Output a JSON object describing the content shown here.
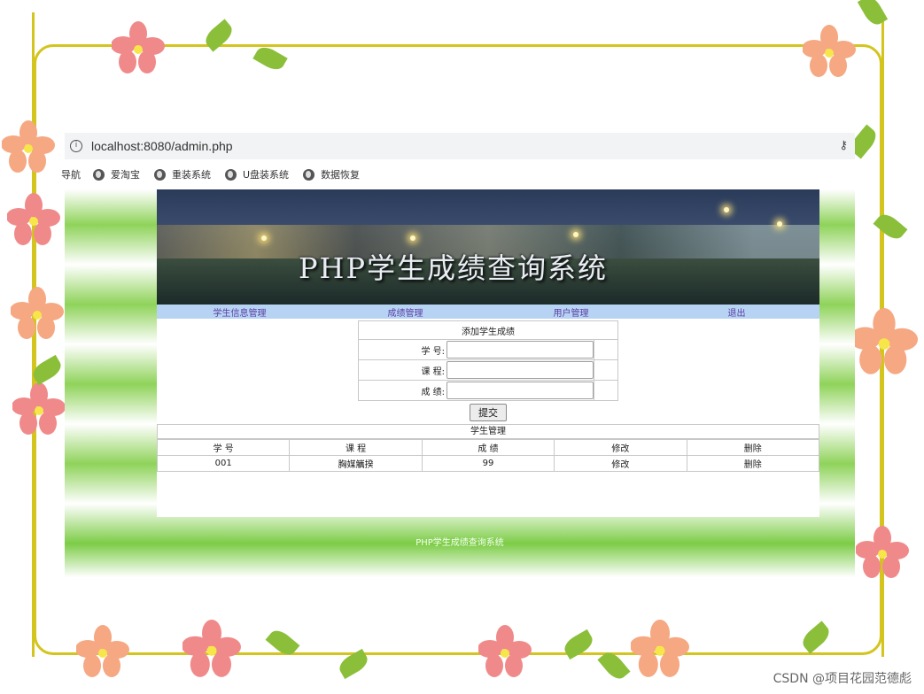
{
  "browser": {
    "url": "localhost:8080/admin.php",
    "bookmarks": [
      "导航",
      "爱淘宝",
      "重装系统",
      "U盘装系统",
      "数据恢复"
    ]
  },
  "site": {
    "banner_title": "PHP学生成绩查询系统",
    "nav": [
      "学生信息管理",
      "成绩管理",
      "用户管理",
      "退出"
    ],
    "form": {
      "title": "添加学生成绩",
      "fields": [
        {
          "label": "学  号:",
          "value": ""
        },
        {
          "label": "课  程:",
          "value": ""
        },
        {
          "label": "成  绩:",
          "value": ""
        }
      ],
      "submit_label": "提交"
    },
    "table": {
      "title": "学生管理",
      "headers": [
        "学  号",
        "课  程",
        "成  绩",
        "修改",
        "删除"
      ],
      "rows": [
        [
          "001",
          "胸媒觿揆",
          "99",
          "修改",
          "删除"
        ]
      ]
    },
    "footer": "PHP学生成绩查询系统"
  },
  "watermark": "CSDN @项目花园范德彪",
  "colors": {
    "frame": "#d4c41e",
    "nav_bg": "#b7d3f4",
    "nav_text": "#5b3fa2",
    "page_green": "#8fd35a",
    "flower_pink": "#f08a8a",
    "flower_peach": "#f5a882",
    "leaf": "#8bbf3a"
  }
}
